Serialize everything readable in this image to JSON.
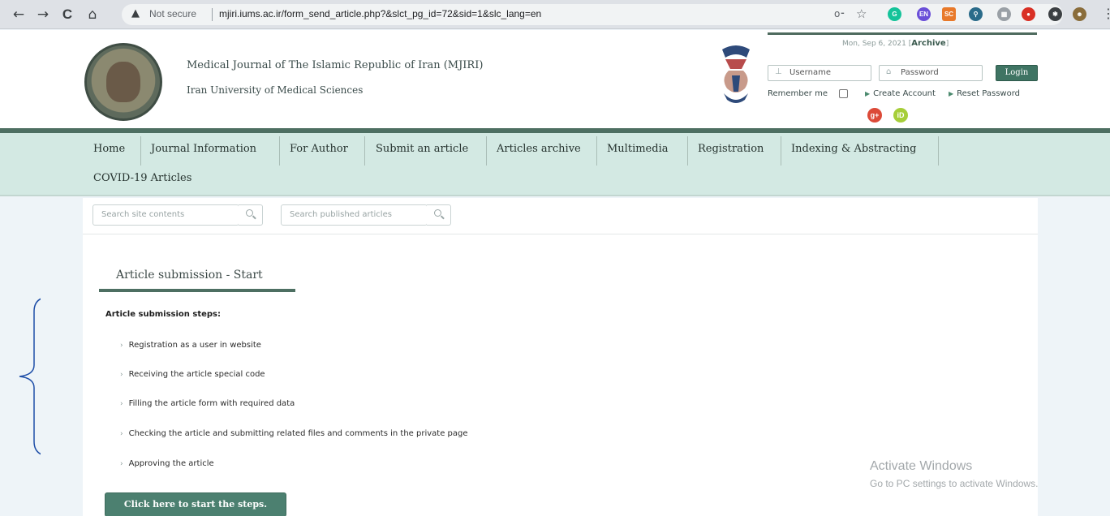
{
  "browser": {
    "back_icon": "←",
    "forward_icon": "→",
    "reload_icon": "C",
    "home_icon": "⌂",
    "security_warning_icon": "▲",
    "security_label": "Not secure",
    "url": "mjiri.iums.ac.ir/form_send_article.php?&slct_pg_id=72&sid=1&slc_lang=en",
    "key_icon": "o⁃",
    "star_icon": "☆",
    "extensions": [
      {
        "name": "grammarly-icon",
        "label": "G",
        "color": "#15c39a"
      },
      {
        "name": "en-extension-icon",
        "label": "EN",
        "color": "#6a4fd8"
      },
      {
        "name": "sc-extension-icon",
        "label": "SC",
        "color": "#e8792a"
      },
      {
        "name": "pin-extension-icon",
        "label": "⚲",
        "color": "#2a6b8a"
      },
      {
        "name": "grid-extension-icon",
        "label": "▦",
        "color": "#9aa0a6"
      },
      {
        "name": "marker-extension-icon",
        "label": "●",
        "color": "#d93025"
      },
      {
        "name": "puzzle-icon",
        "label": "✱",
        "color": "#3c4043"
      },
      {
        "name": "profile-avatar",
        "label": "☻",
        "color": "#8a6d3b"
      }
    ],
    "menu_icon": "⋮"
  },
  "header": {
    "journal_title": "Medical Journal of The Islamic Republic of Iran (MJIRI)",
    "journal_subtitle": "Iran University of Medical Sciences",
    "date_text": "Mon, Sep 6, 2021 [",
    "archive_label": "Archive",
    "date_close": "]",
    "username_placeholder": "Username",
    "password_placeholder": "Password",
    "login_label": "Login",
    "remember_label": "Remember me",
    "create_account": "Create Account",
    "reset_password": "Reset Password",
    "google_plus_label": "g+",
    "orcid_label": "iD"
  },
  "nav": {
    "items": [
      "Home",
      "Journal Information",
      "For Author",
      "Submit an article",
      "Articles archive",
      "Multimedia",
      "Registration",
      "Indexing & Abstracting",
      "COVID-19 Articles"
    ]
  },
  "search": {
    "site_placeholder": "Search site contents",
    "articles_placeholder": "Search published articles"
  },
  "main": {
    "page_title": "Article submission - Start",
    "steps_heading": "Article submission steps:",
    "steps": [
      "Registration as a user in website",
      "Receiving the article special code",
      "Filling the article form with required data",
      "Checking the article and submitting related files and comments in the private page",
      "Approving the article"
    ],
    "start_button": "Click here to start the steps."
  },
  "watermark": {
    "title": "Activate Windows",
    "subtitle": "Go to PC settings to activate Windows."
  },
  "colors": {
    "brand_green": "#4d6f62",
    "nav_bg": "#d3e9e3",
    "button_green": "#4c8070",
    "annotation_blue": "#1f4fa8"
  }
}
